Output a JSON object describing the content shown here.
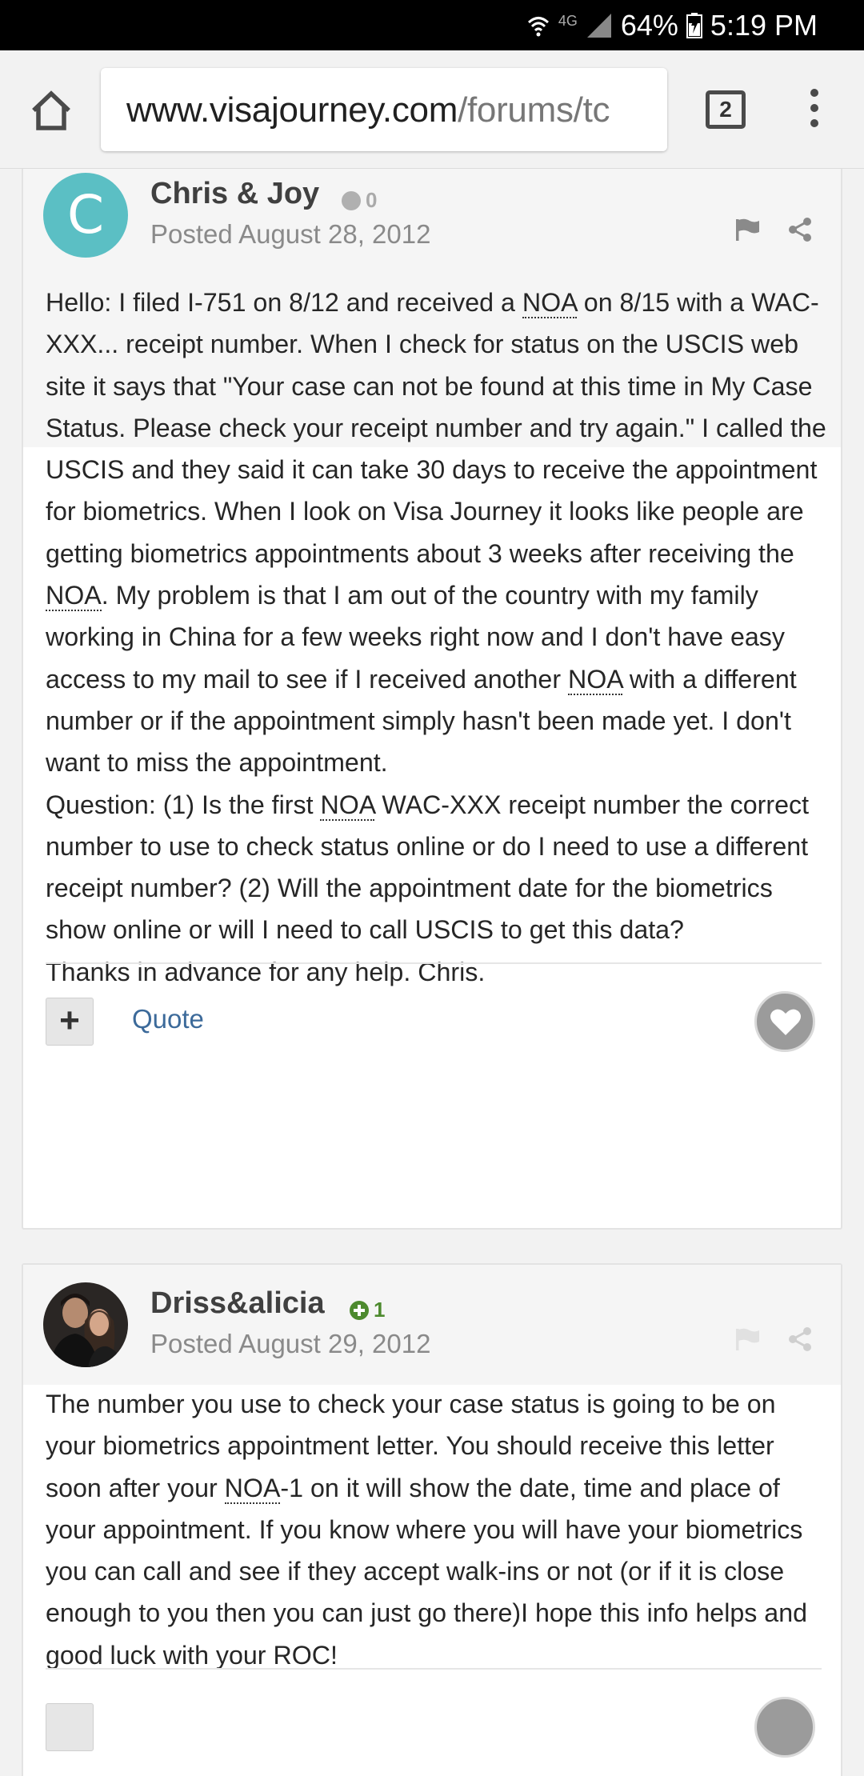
{
  "status_bar": {
    "network": "4G",
    "battery": "64%",
    "time": "5:19 PM"
  },
  "browser": {
    "url_domain": "www.visajourney.com",
    "url_path": "/forums/tc",
    "tab_count": "2"
  },
  "posts": [
    {
      "author": "Chris & Joy",
      "avatar_letter": "C",
      "reputation": "0",
      "posted": "Posted August 28, 2012",
      "paragraphs": [
        [
          {
            "t": "Hello: I filed I-751 on 8/12 and received a "
          },
          {
            "t": "NOA",
            "abbr": true
          },
          {
            "t": " on 8/15 with a WAC-XXX... receipt number. When I check for status on the USCIS web site it says that \"Your case can not be found at this time in My Case Status. Please check your receipt number and try again.\" I called the USCIS and they said it can take 30 days to receive the appointment for biometrics. When I look on Visa Journey it looks like people are getting biometrics appointments about 3 weeks after receiving the "
          },
          {
            "t": "NOA",
            "abbr": true
          },
          {
            "t": ". My problem is that I am out of the country with my family working in China for a few weeks right now and I don't have easy access to my mail to see if I received another "
          },
          {
            "t": "NOA",
            "abbr": true
          },
          {
            "t": " with a different number or if the appointment simply hasn't been made yet. I don't want to miss the appointment."
          }
        ],
        [
          {
            "t": "Question: (1) Is the first "
          },
          {
            "t": "NOA",
            "abbr": true
          },
          {
            "t": " WAC-XXX receipt number the correct number to use to check status online or do I need to use a different receipt number? (2) Will the appointment date for the biometrics show online or will I need to call USCIS to get this data?"
          }
        ],
        [
          {
            "t": "Thanks in advance for any help. Chris."
          }
        ]
      ],
      "quote_label": "Quote",
      "plus_label": "+"
    },
    {
      "author": "Driss&alicia",
      "reputation": "1",
      "posted": "Posted August 29, 2012",
      "paragraphs": [
        [
          {
            "t": "The number you use to check your case status is going to be on your biometrics appointment letter. You should receive this letter soon after your "
          },
          {
            "t": "NOA",
            "abbr": true
          },
          {
            "t": "-1 on it will show the date, time and place of your appointment. If you know where you will have your biometrics you can call and see if they accept walk-ins or not (or if it is close enough to you then you can just go there)I hope this info helps and good luck with your ROC!"
          }
        ]
      ]
    }
  ]
}
